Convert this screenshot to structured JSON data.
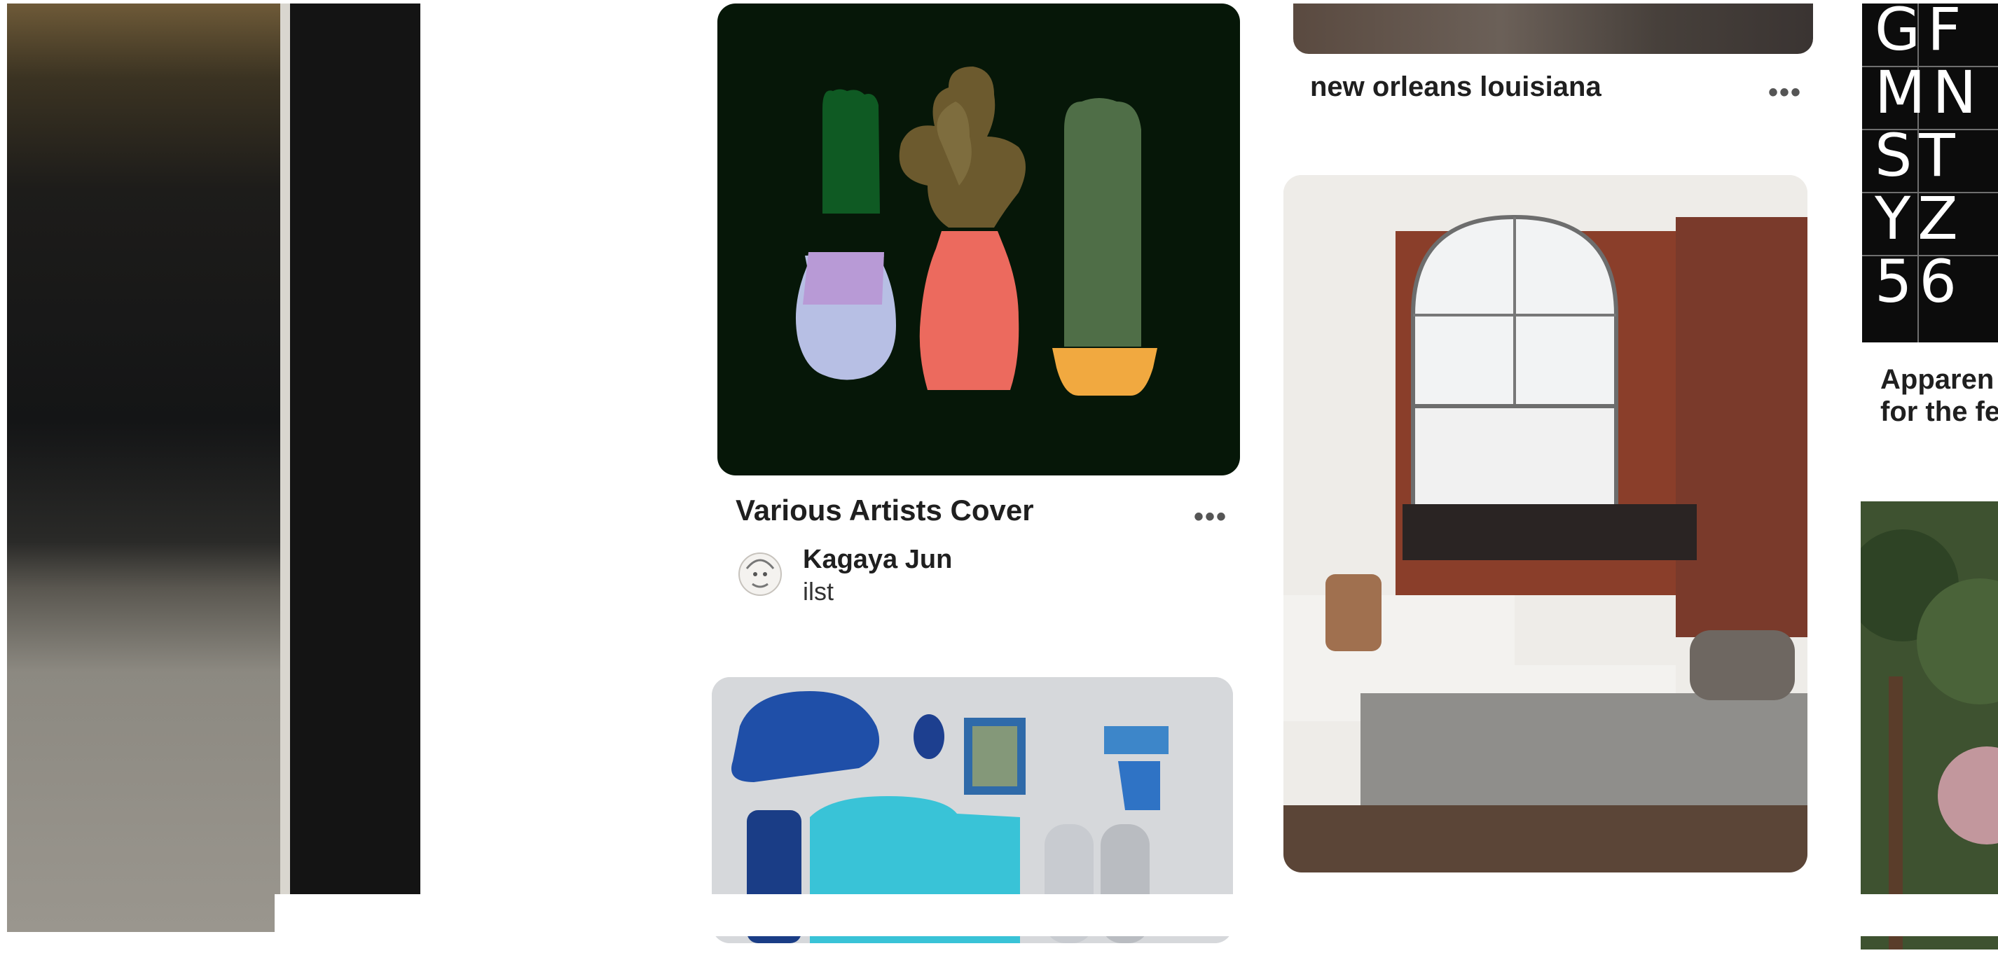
{
  "pins": {
    "cactus": {
      "title": "Various Artists Cover",
      "author_name": "Kagaya Jun",
      "author_sub": "ilst",
      "more": "•••"
    },
    "nola": {
      "title": "new orleans louisiana",
      "more": "•••"
    },
    "interior": {
      "more": "•••"
    },
    "typography": {
      "glyph_rows": [
        "GF",
        "MN",
        "ST",
        "YZ",
        "56"
      ],
      "title_line1": "Apparen",
      "title_line2": "for the fe"
    }
  }
}
